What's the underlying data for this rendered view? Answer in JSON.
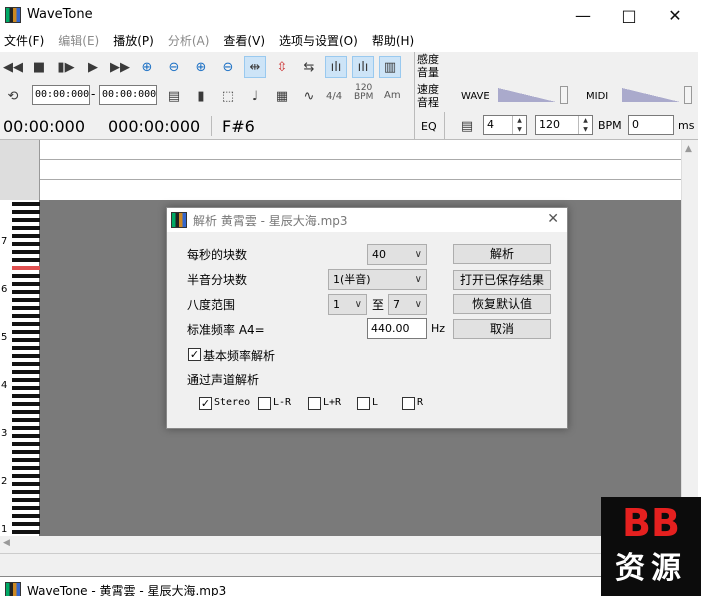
{
  "window": {
    "title": "WaveTone",
    "min": "—",
    "max": "□",
    "close": "✕"
  },
  "menu": [
    {
      "label": "文件(F)",
      "disabled": false
    },
    {
      "label": "编辑(E)",
      "disabled": true
    },
    {
      "label": "播放(P)",
      "disabled": false
    },
    {
      "label": "分析(A)",
      "disabled": true
    },
    {
      "label": "查看(V)",
      "disabled": false
    },
    {
      "label": "选项与设置(O)",
      "disabled": false
    },
    {
      "label": "帮助(H)",
      "disabled": false
    }
  ],
  "toolbar": {
    "time_start": "00:00:000",
    "time_dash": "-",
    "time_end": "00:00:000",
    "beat_label": "4/4",
    "tempo_top": "120",
    "tempo_bottom": "BPM",
    "key_label": "Am",
    "sense_top": "感度",
    "sense_bottom": "音量",
    "speed_top": "速度",
    "speed_bottom": "音程",
    "eq": "EQ",
    "wave": "WAVE",
    "midi": "MIDI",
    "beats_value": "4",
    "bpm_value": "120",
    "bpm_label": "BPM",
    "ms_value": "0",
    "ms_label": "ms"
  },
  "status": {
    "position": "00:00:000",
    "length": "000:00:000",
    "note": "F#6"
  },
  "piano_octaves": [
    "7",
    "6",
    "5",
    "4",
    "3",
    "2",
    "1"
  ],
  "dialog": {
    "title": "解析 黄霄雲 - 星辰大海.mp3",
    "blocks_label": "每秒的块数",
    "blocks_value": "40",
    "semitone_label": "半音分块数",
    "semitone_value": "1(半音)",
    "octave_label": "八度范围",
    "octave_from": "1",
    "octave_to_label": "至",
    "octave_to": "7",
    "freq_label": "标准频率 A4=",
    "freq_value": "440.00",
    "freq_unit": "Hz",
    "fundamental_label": "基本频率解析",
    "fundamental_checked": true,
    "channel_label": "通过声道解析",
    "channels": [
      {
        "label": "Stereo",
        "checked": true
      },
      {
        "label": "L-R",
        "checked": false
      },
      {
        "label": "L+R",
        "checked": false
      },
      {
        "label": "L",
        "checked": false
      },
      {
        "label": "R",
        "checked": false
      }
    ],
    "btn_analyze": "解析",
    "btn_open": "打开已保存结果",
    "btn_restore": "恢复默认值",
    "btn_cancel": "取消"
  },
  "second_window": {
    "title": "WaveTone - 黄霄雲 - 星辰大海.mp3"
  },
  "watermark": {
    "line1": "BB",
    "line2": "资源"
  }
}
